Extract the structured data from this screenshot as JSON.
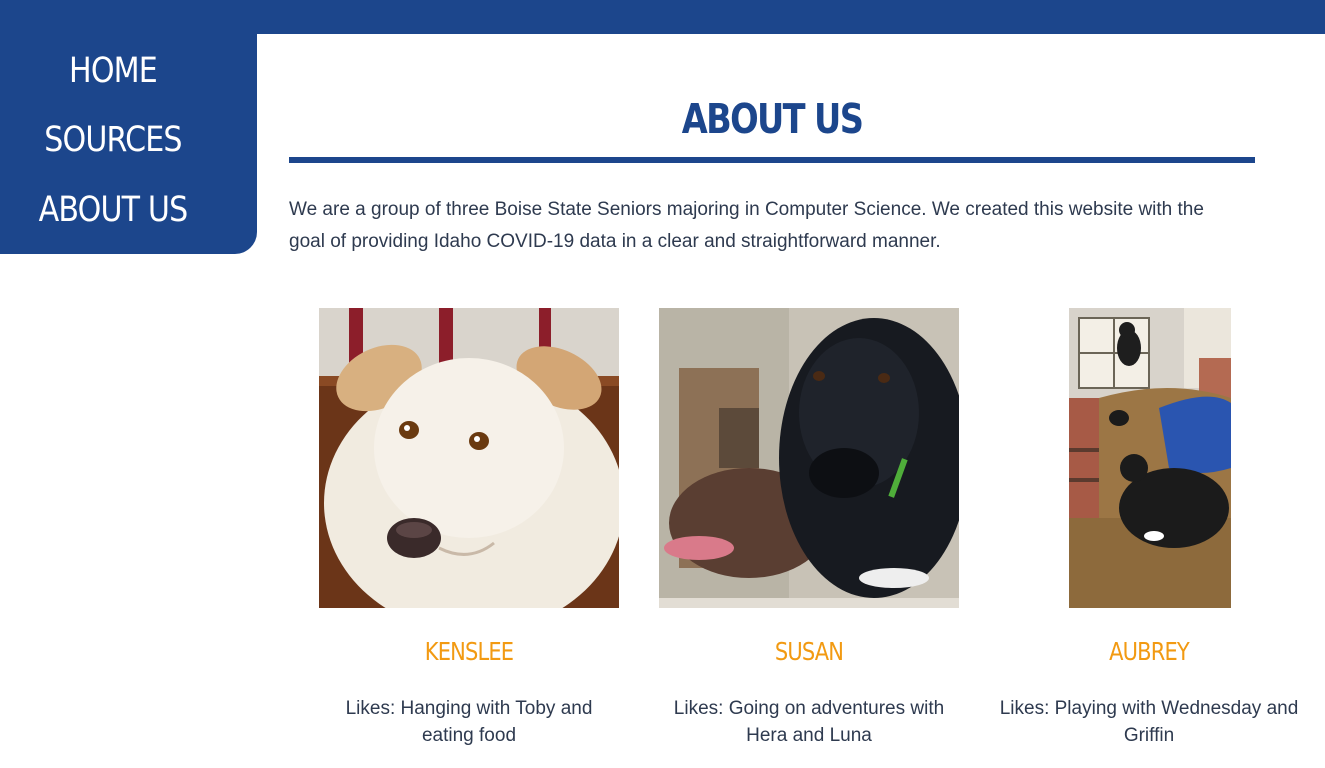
{
  "nav": {
    "items": [
      {
        "label": "HOME"
      },
      {
        "label": "SOURCES"
      },
      {
        "label": "ABOUT US"
      }
    ]
  },
  "main": {
    "title": "ABOUT US",
    "intro": "We are a group of three Boise State Seniors majoring in Computer Science. We created this website with the goal of providing Idaho COVID-19 data in a clear and straightforward manner."
  },
  "team": [
    {
      "name": "KENSLEE",
      "likes": "Likes: Hanging with Toby and eating food"
    },
    {
      "name": "SUSAN",
      "likes": "Likes: Going on adventures with Hera and Luna"
    },
    {
      "name": "AUBREY",
      "likes": "Likes: Playing with Wednesday and Griffin"
    }
  ],
  "colors": {
    "brand_blue": "#1c468c",
    "accent_orange": "#f29a12",
    "body_text": "#2e3a4f"
  }
}
